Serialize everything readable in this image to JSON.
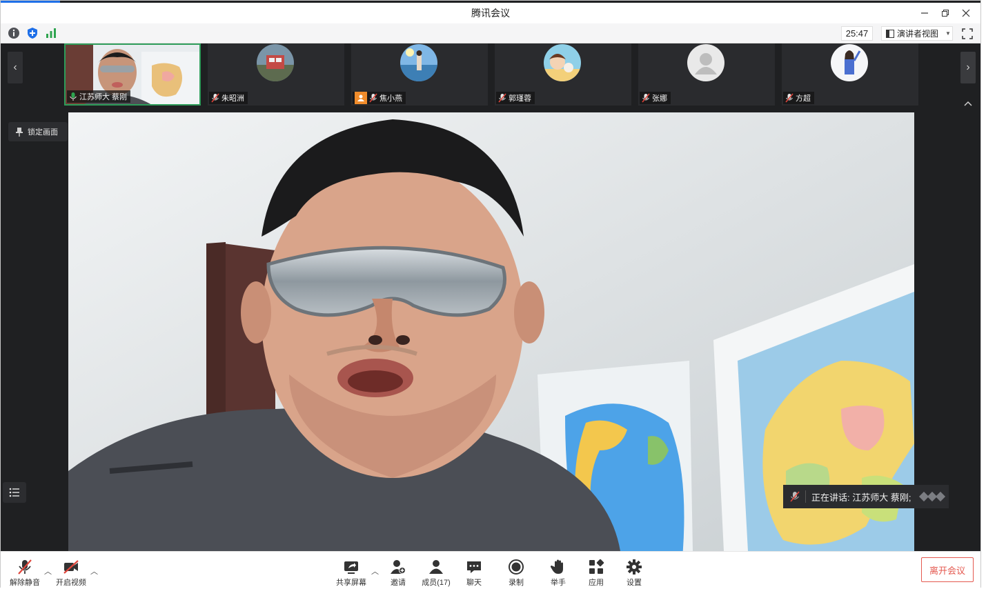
{
  "window": {
    "title": "腾讯会议",
    "controls": [
      "minimize-icon",
      "restore-icon",
      "close-icon"
    ]
  },
  "infobar": {
    "icons": [
      "info-icon",
      "shield-icon",
      "signal-icon"
    ],
    "timer": "25:47",
    "view_mode": "演讲者视图",
    "fullscreen_icon": "fullscreen-icon"
  },
  "participants": [
    {
      "name": "江苏师大 蔡刚",
      "mic": "on",
      "active": true
    },
    {
      "name": "朱昭洲",
      "mic": "off"
    },
    {
      "name": "焦小燕",
      "mic": "off",
      "badge": "host"
    },
    {
      "name": "郭瑾蓉",
      "mic": "off"
    },
    {
      "name": "张娜",
      "mic": "off"
    },
    {
      "name": "方超",
      "mic": "off"
    }
  ],
  "stage": {
    "lock_label": "锁定画面",
    "speaking_text": "正在讲话: 江苏师大 蔡刚;"
  },
  "toolbar": {
    "unmute": "解除静音",
    "start_video": "开启视频",
    "share_screen": "共享屏幕",
    "invite": "邀请",
    "members": "成员(17)",
    "chat": "聊天",
    "record": "录制",
    "raise_hand": "举手",
    "apps": "应用",
    "settings": "设置",
    "leave": "离开会议"
  },
  "colors": {
    "accent": "#1e6fe8",
    "active_border": "#2e9d5a",
    "leave": "#e4584f",
    "mic_off": "#e0453b"
  }
}
